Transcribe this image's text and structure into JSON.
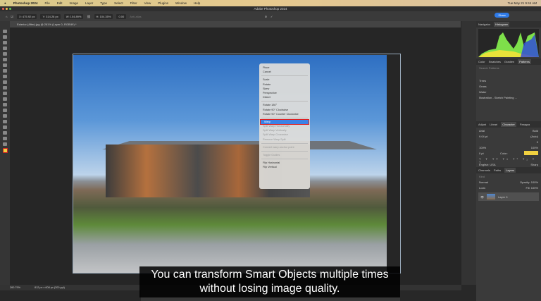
{
  "menubar": {
    "app": "Photoshop 2024",
    "items": [
      "File",
      "Edit",
      "Image",
      "Layer",
      "Type",
      "Select",
      "Filter",
      "View",
      "Plugins",
      "Window",
      "Help"
    ],
    "clock": "Tue May 21 9:44 AM"
  },
  "window_title": "Adobe Photoshop 2024",
  "options": {
    "x": "X: 475.92 px",
    "y": "Y: 314.28 px",
    "w": "W: 104.89%",
    "h": "H: 104.35%",
    "angle": "0.00",
    "antialias": "Anti-alias",
    "share": "Share"
  },
  "document_tab": "Exterior (After).jpg @ 261% (Layer 0, RGB/8*) *",
  "context_menu": {
    "items": [
      {
        "label": "Place",
        "state": "enabled"
      },
      {
        "label": "Cancel",
        "state": "enabled"
      },
      {
        "sep": true
      },
      {
        "label": "Scale",
        "state": "enabled"
      },
      {
        "label": "Rotate",
        "state": "enabled"
      },
      {
        "label": "Skew",
        "state": "enabled"
      },
      {
        "label": "Perspective",
        "state": "enabled"
      },
      {
        "label": "Distort",
        "state": "enabled"
      },
      {
        "sep": true
      },
      {
        "label": "Rotate 180°",
        "state": "enabled"
      },
      {
        "label": "Rotate 90° Clockwise",
        "state": "enabled"
      },
      {
        "label": "Rotate 90° Counter Clockwise",
        "state": "enabled"
      },
      {
        "sep": true
      },
      {
        "label": "Warp",
        "state": "selected"
      },
      {
        "label": "Split Warp Horizontally",
        "state": "disabled"
      },
      {
        "label": "Split Warp Vertically",
        "state": "disabled"
      },
      {
        "label": "Split Warp Crosswise",
        "state": "disabled"
      },
      {
        "label": "Remove Warp Split",
        "state": "disabled"
      },
      {
        "sep": true
      },
      {
        "label": "Convert warp anchor point",
        "state": "disabled"
      },
      {
        "sep": true
      },
      {
        "label": "Toggle Guides",
        "state": "disabled"
      },
      {
        "sep": true
      },
      {
        "label": "Flip Horizontal",
        "state": "enabled"
      },
      {
        "label": "Flip Vertical",
        "state": "enabled"
      }
    ]
  },
  "panels": {
    "top_tabs": [
      "Navigator",
      "Histogram"
    ],
    "mid_tabs": [
      "Color",
      "Swatches",
      "Gradien",
      "Patterns"
    ],
    "search_placeholder": "Search Patterns",
    "pattern_groups": [
      "Trees",
      "Grass",
      "Water",
      "Illustration - Sketch Painting ..."
    ],
    "char_tabs": [
      "Adjust",
      "Librari",
      "Character",
      "Paragra"
    ],
    "font": "Arial",
    "style": "Bold",
    "size": "9.04 pt",
    "leading": "(Auto)",
    "tracking": "0",
    "vscale": "100%",
    "hscale": "100%",
    "baseline": "0 pt",
    "color_label": "Color:",
    "text_color": "#f0d040",
    "language": "English: USA",
    "aa": "Sharp",
    "layer_tabs": [
      "Channels",
      "Paths",
      "Layers"
    ],
    "kind": "Kind",
    "blend": "Normal",
    "opacity": "Opacity: 100%",
    "lock": "Lock:",
    "fill": "Fill: 100%",
    "layer_name": "Layer 0"
  },
  "status": {
    "zoom": "260.79%",
    "dims": "812 px x 608 px (300 ppi)"
  },
  "caption": {
    "line1": "You can transform Smart Objects multiple times",
    "line2": "without losing image quality."
  }
}
